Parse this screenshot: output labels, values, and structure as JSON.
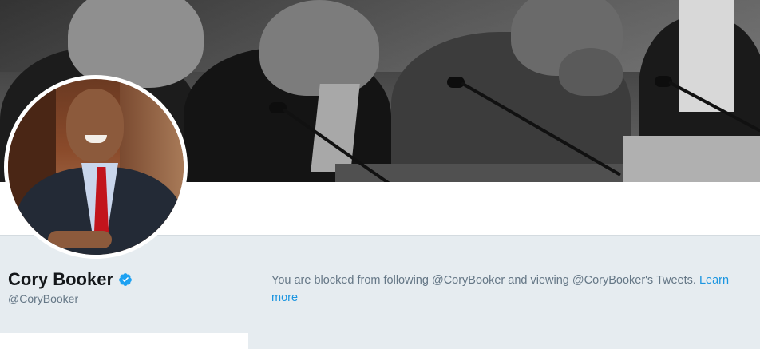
{
  "banner": {
    "icon": "profile-header-photo"
  },
  "avatar": {
    "icon": "profile-avatar-photo"
  },
  "profile": {
    "display_name": "Cory Booker",
    "handle": "@CoryBooker",
    "verified_icon": "verified-badge-icon",
    "verified_color": "#1da1f2"
  },
  "blocked": {
    "message": "You are blocked from following @CoryBooker and viewing @CoryBooker's Tweets.",
    "link_label": "Learn more",
    "link_color": "#1b95e0"
  }
}
